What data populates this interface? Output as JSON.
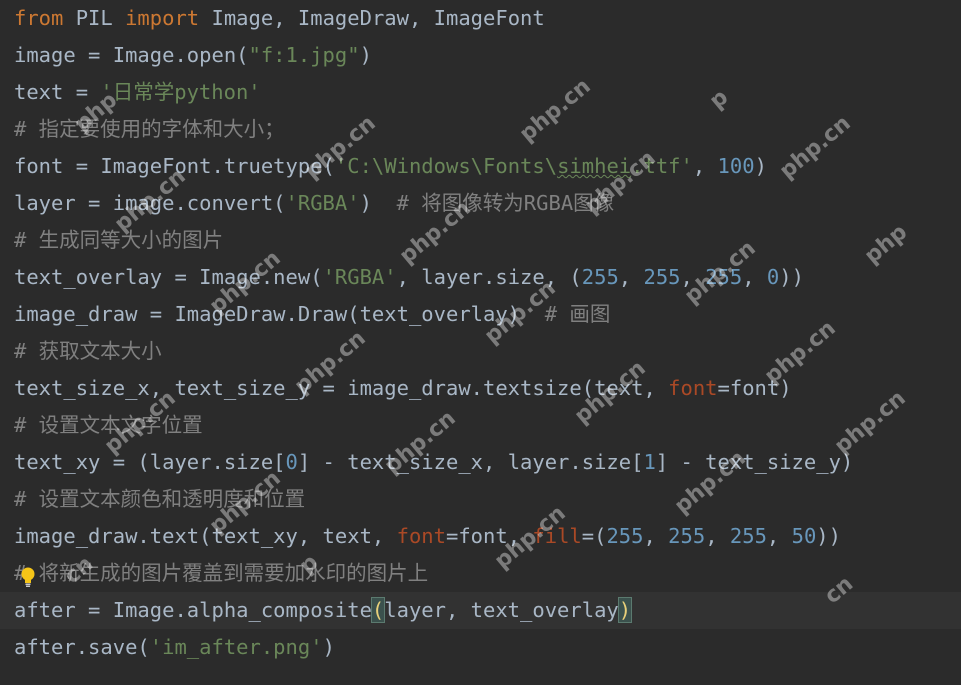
{
  "colors": {
    "background": "#2b2b2b",
    "current_line": "#323232",
    "keyword": "#cc7832",
    "plain": "#a9b7c6",
    "string": "#6a8759",
    "number": "#6897bb",
    "param": "#aa4926",
    "comment": "#808080",
    "bracket_match": "#3b514d"
  },
  "watermark": {
    "text": "php.cn",
    "partial_php": "php",
    "partial_cn": "cn",
    "partial_p": "p"
  },
  "code": {
    "line1": {
      "kw_from": "from",
      "p1": " PIL ",
      "kw_import": "import",
      "p2": " Image, ImageDraw, ImageFont"
    },
    "line2": {
      "p1": "image = Image.open(",
      "s1": "\"f:1.jpg\"",
      "p2": ")"
    },
    "line3": {
      "p1": "text = ",
      "s1": "'日常学python'"
    },
    "line4": {
      "c1": "# 指定要使用的字体和大小；"
    },
    "line5": {
      "p1": "font = ImageFont.truetype(",
      "s1": "'C:\\Windows\\Fonts\\",
      "s_sq": "simhei",
      "s2": ".ttf'",
      "p2": ", ",
      "n1": "100",
      "p3": ")"
    },
    "line6": {
      "p1": "layer = image.convert(",
      "s1": "'RGBA'",
      "p2": ")  ",
      "c1": "# 将图像转为RGBA图像"
    },
    "line7": {
      "c1": "# 生成同等大小的图片"
    },
    "line8": {
      "p1": "text_overlay = Image.new(",
      "s1": "'RGBA'",
      "p2": ", layer.size, (",
      "n1": "255",
      "p3": ", ",
      "n2": "255",
      "p4": ", ",
      "n3": "255",
      "p5": ", ",
      "n4": "0",
      "p6": "))"
    },
    "line9": {
      "p1": "image_draw = ImageDraw.Draw(text_overlay)  ",
      "c1": "# 画图"
    },
    "line10": {
      "c1": "# 获取文本大小"
    },
    "line11": {
      "p1": "text_size_x, text_size_y = image_draw.textsize(text, ",
      "k1": "font",
      "p2": "=font)"
    },
    "line12": {
      "c1": "# 设置文本文字位置"
    },
    "line13": {
      "p1": "text_xy = (layer.size[",
      "n1": "0",
      "p2": "] - text_size_x, layer.size[",
      "n2": "1",
      "p3": "] - text_size_y)"
    },
    "line14": {
      "c1": "# 设置文本颜色和透明度和位置"
    },
    "line15": {
      "p1": "image_draw.text(text_xy, text, ",
      "k1": "font",
      "p2": "=font, ",
      "k2": "fill",
      "p3": "=(",
      "n1": "255",
      "p4": ", ",
      "n2": "255",
      "p5": ", ",
      "n3": "255",
      "p6": ", ",
      "n4": "50",
      "p7": "))"
    },
    "line16": {
      "c1": "# 将新生成的图片覆盖到需要加水印的图片上"
    },
    "line17": {
      "p1": "after = Image.alpha_composite",
      "b_open": "(",
      "p2": "layer, text_overlay",
      "b_close": ")"
    },
    "line18": {
      "p1": "after.save(",
      "s1": "'im_after.png'",
      "p2": ")"
    }
  }
}
